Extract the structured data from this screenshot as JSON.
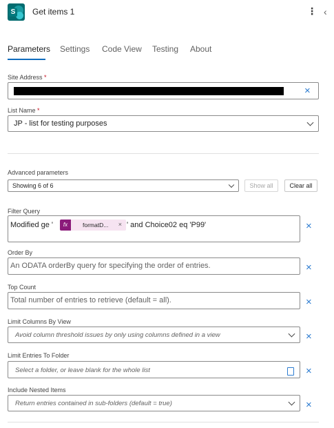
{
  "header": {
    "title": "Get items 1",
    "logo_letter": "S"
  },
  "tabs": [
    {
      "label": "Parameters",
      "active": true
    },
    {
      "label": "Settings",
      "active": false
    },
    {
      "label": "Code View",
      "active": false
    },
    {
      "label": "Testing",
      "active": false
    },
    {
      "label": "About",
      "active": false
    }
  ],
  "site_address": {
    "label": "Site Address",
    "required_mark": "*",
    "value_redacted": true
  },
  "list_name": {
    "label": "List Name",
    "required_mark": "*",
    "value": "JP - list for testing purposes"
  },
  "advanced": {
    "label": "Advanced parameters",
    "dropdown_value": "Showing 6 of 6",
    "show_all_label": "Show all",
    "clear_all_label": "Clear all"
  },
  "filter_query": {
    "label": "Filter Query",
    "prefix": "Modified ge '",
    "token": {
      "icon": "fx",
      "name": "formatD...",
      "remove": "×"
    },
    "suffix": "' and Choice02 eq 'P99'"
  },
  "order_by": {
    "label": "Order By",
    "placeholder": "An ODATA orderBy query for specifying the order of entries."
  },
  "top_count": {
    "label": "Top Count",
    "placeholder": "Total number of entries to retrieve (default = all)."
  },
  "limit_columns": {
    "label": "Limit Columns By View",
    "placeholder": "Avoid column threshold issues by only using columns defined in a view"
  },
  "limit_folder": {
    "label": "Limit Entries To Folder",
    "placeholder": "Select a folder, or leave blank for the whole list"
  },
  "nested_items": {
    "label": "Include Nested Items",
    "placeholder": "Return entries contained in sub-folders (default = true)"
  },
  "icons": {
    "clear": "×",
    "kebab": "⋮",
    "collapse": "‹"
  },
  "colors": {
    "accent": "#0f6cbd",
    "clear_icon": "#2b7bd0",
    "required": "#c50f1f",
    "function_token": "#8b1a7a",
    "token_bg": "#f6e3f1",
    "logo": "#036c70"
  }
}
